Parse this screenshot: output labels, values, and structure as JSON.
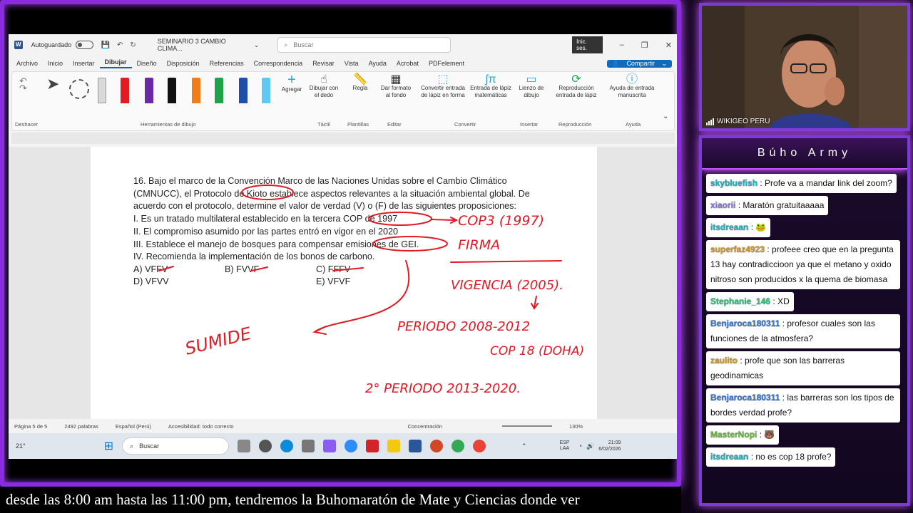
{
  "word": {
    "autosave_label": "Autoguardado",
    "doc_title": "SEMINARIO 3 CAMBIO CLIMA...",
    "search_placeholder": "Buscar",
    "signin_label": "Inic. ses.",
    "share_label": "Compartir",
    "menu": [
      "Archivo",
      "Inicio",
      "Insertar",
      "Dibujar",
      "Diseño",
      "Disposición",
      "Referencias",
      "Correspondencia",
      "Revisar",
      "Vista",
      "Ayuda",
      "Acrobat",
      "PDFelement"
    ],
    "active_menu": "Dibujar",
    "ribbon": {
      "undo_group": "Deshacer",
      "drawing_tools_group": "Herramientas de dibujo",
      "add_label": "Agregar",
      "draw_finger": "Dibujar con el dedo",
      "touch_group": "Táctil",
      "ruler": "Regla",
      "templates_group": "Plantillas",
      "format_bg": "Dar formato al fondo",
      "edit_group": "Editar",
      "ink_to_shape": "Convertir entrada de lápiz en forma",
      "ink_to_math": "Entrada de lápiz matemáticas",
      "convert_group": "Convertir",
      "canvas": "Lienzo de dibujo",
      "insert_group": "Insertar",
      "replay": "Reproducción entrada de lápiz",
      "replay_group": "Reproducción",
      "help_ink": "Ayuda de entrada manuscrita",
      "help_group": "Ayuda"
    },
    "question": {
      "lines": [
        "16. Bajo el marco de la Convención Marco de las Naciones Unidas sobre el Cambio Climático",
        "(CMNUCC), el Protocolo de Kioto establece aspectos relevantes a la situación ambiental global. De",
        "acuerdo con el protocolo, determine el valor de verdad (V) o (F) de las siguientes proposiciones:",
        "I. Es un tratado multilateral establecido en la tercera COP de 1997",
        "II. El compromiso asumido por las partes entró en vigor en el 2020",
        "III. Establece el manejo de bosques para compensar emisiones de GEI.",
        "IV. Recomienda la implementación de los bonos de carbono."
      ],
      "options": {
        "a": "A) VFFV",
        "b": "B) FVVF",
        "c": "C) FFFV",
        "d": "D) VFVV",
        "e": "E) VFVF"
      }
    },
    "ink_notes": [
      "COP3 (1997)",
      "FIRMA",
      "VIGENCIA (2005).",
      "PERIODO 2008-2012",
      "COP 18 (DOHA)",
      "2° PERIODO 2013-2020.",
      "SUMIDE"
    ],
    "status": {
      "page": "Página 5 de 5",
      "words": "2492 palabras",
      "language": "Español (Perú)",
      "accessibility": "Accesibilidad: todo correcto",
      "focus": "Concentración",
      "zoom": "130%"
    },
    "taskbar": {
      "weather": "21°",
      "search": "Buscar",
      "lang1": "ESP",
      "lang2": "LAA",
      "time": "21:09",
      "date": "6/02/2026"
    }
  },
  "ticker_text": "desde las 8:00 am hasta las 11:00 pm, tendremos la Buhomaratón de Mate y Ciencias donde ver",
  "webcam": {
    "label": "WIKIGEO PERU"
  },
  "chat": {
    "title": "Búho Army",
    "messages": [
      {
        "user": "skybluefish",
        "text": ": Profe va a mandar link del zoom?",
        "color": "u-teal"
      },
      {
        "user": "xiaorii",
        "text": ": Maratón gratuitaaaaa",
        "color": "u-lav"
      },
      {
        "user": "itsdreaan",
        "text": ": 🐸",
        "color": "u-teal"
      },
      {
        "user": "superfaz4923",
        "text": ": profeee creo que en la pregunta 13 hay contradiccioon ya que el metano y oxido nitroso son producidos x la quema de biomasa",
        "color": "u-gold"
      },
      {
        "user": "Stephanie_146",
        "text": ": XD",
        "color": "u-green"
      },
      {
        "user": "Benjaroca180311",
        "text": ": profesor cuales son las funciones de la atmosfera?",
        "color": "u-blue"
      },
      {
        "user": "zaulito",
        "text": ": profe que son las barreras geodinamicas",
        "color": "u-gold"
      },
      {
        "user": "Benjaroca180311",
        "text": ": las barreras son los tipos de bordes verdad profe?",
        "color": "u-blue"
      },
      {
        "user": "MasterNopi",
        "text": ": 🐻",
        "color": "u-lime"
      },
      {
        "user": "itsdreaan",
        "text": ": no es cop 18 profe?",
        "color": "u-teal"
      }
    ]
  }
}
